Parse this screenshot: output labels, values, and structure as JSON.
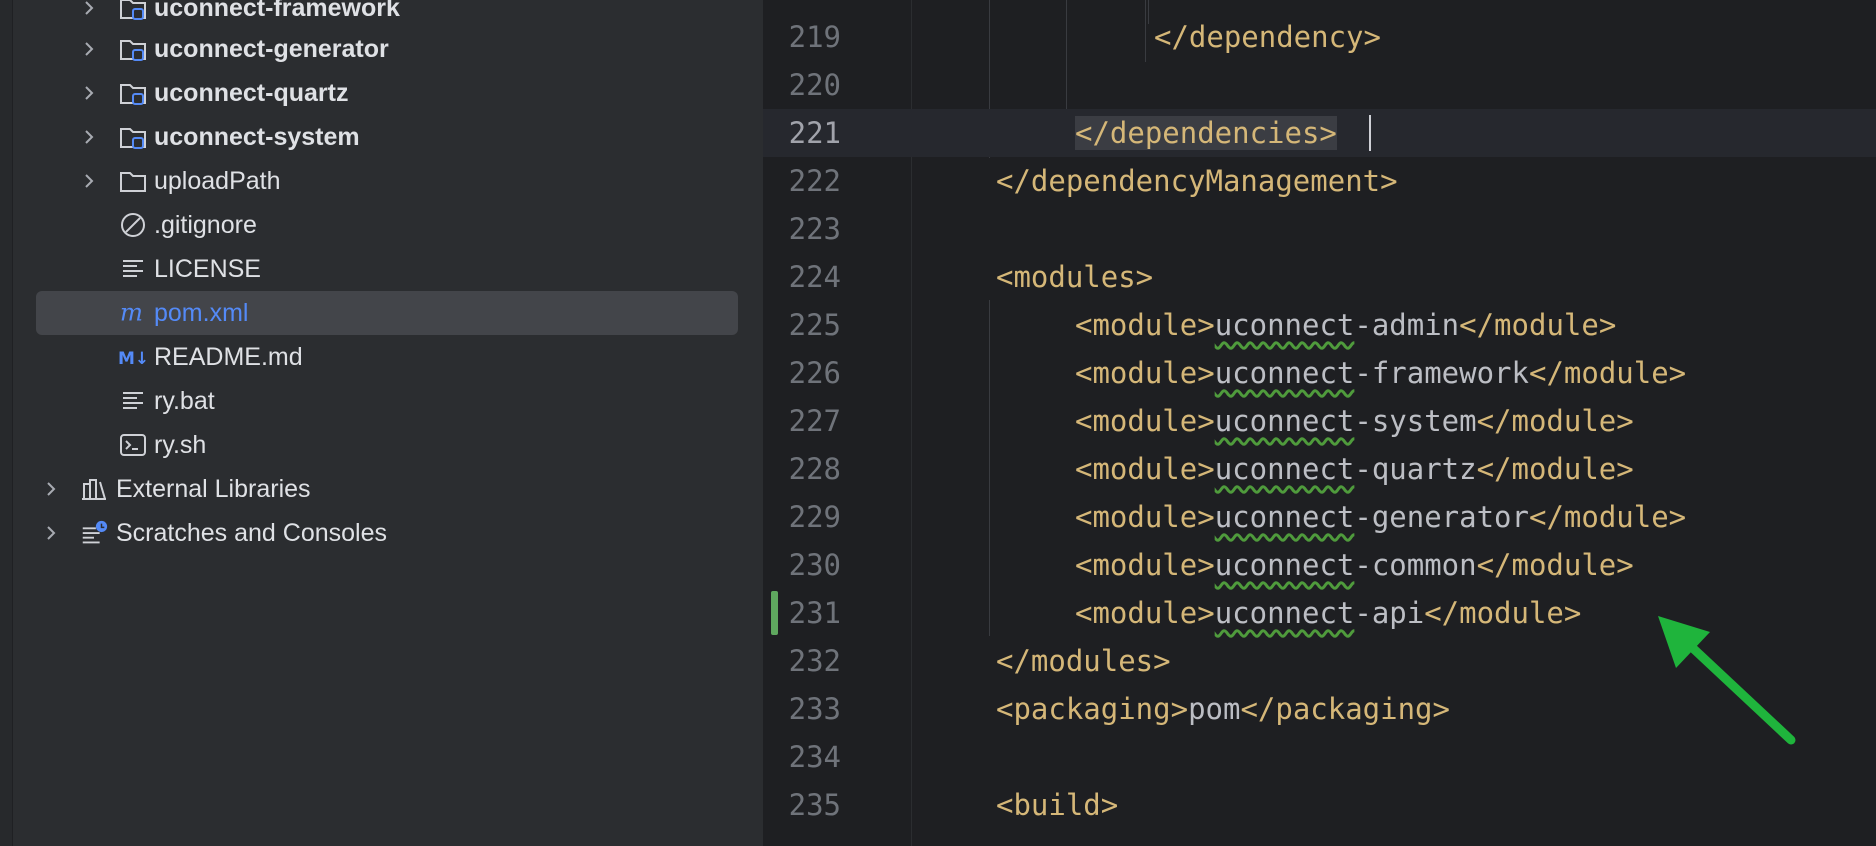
{
  "project_tree": {
    "items": [
      {
        "label": "uconnect-framework",
        "kind": "module-folder",
        "expandable": true
      },
      {
        "label": "uconnect-generator",
        "kind": "module-folder",
        "expandable": true
      },
      {
        "label": "uconnect-quartz",
        "kind": "module-folder",
        "expandable": true
      },
      {
        "label": "uconnect-system",
        "kind": "module-folder",
        "expandable": true
      },
      {
        "label": "uploadPath",
        "kind": "folder",
        "expandable": true
      },
      {
        "label": ".gitignore",
        "kind": "ignore-file"
      },
      {
        "label": "LICENSE",
        "kind": "text-file"
      },
      {
        "label": "pom.xml",
        "kind": "maven-file",
        "selected": true
      },
      {
        "label": "README.md",
        "kind": "markdown-file"
      },
      {
        "label": "ry.bat",
        "kind": "text-file"
      },
      {
        "label": "ry.sh",
        "kind": "shell-file"
      },
      {
        "label": "External Libraries",
        "kind": "libraries",
        "expandable": true
      },
      {
        "label": "Scratches and Consoles",
        "kind": "scratches",
        "expandable": true
      }
    ]
  },
  "editor": {
    "file": "pom.xml",
    "current_line": 221,
    "lines": [
      {
        "n": "219",
        "tokens": [
          {
            "t": "</dependency>",
            "c": "tag"
          }
        ]
      },
      {
        "n": "220",
        "tokens": []
      },
      {
        "n": "221",
        "tokens": [
          {
            "t": "</dependencies>",
            "c": "tag"
          }
        ]
      },
      {
        "n": "222",
        "tokens": [
          {
            "t": "</dependencyManagement>",
            "c": "tag"
          }
        ]
      },
      {
        "n": "223",
        "tokens": []
      },
      {
        "n": "224",
        "tokens": [
          {
            "t": "<modules>",
            "c": "tag"
          }
        ]
      },
      {
        "n": "225",
        "tokens": [
          {
            "t": "<module>",
            "c": "tag"
          },
          {
            "t": "uconnect",
            "c": "squig"
          },
          {
            "t": "-admin",
            "c": "txt"
          },
          {
            "t": "</module>",
            "c": "tag"
          }
        ]
      },
      {
        "n": "226",
        "tokens": [
          {
            "t": "<module>",
            "c": "tag"
          },
          {
            "t": "uconnect",
            "c": "squig"
          },
          {
            "t": "-framework",
            "c": "txt"
          },
          {
            "t": "</module>",
            "c": "tag"
          }
        ]
      },
      {
        "n": "227",
        "tokens": [
          {
            "t": "<module>",
            "c": "tag"
          },
          {
            "t": "uconnect",
            "c": "squig"
          },
          {
            "t": "-system",
            "c": "txt"
          },
          {
            "t": "</module>",
            "c": "tag"
          }
        ]
      },
      {
        "n": "228",
        "tokens": [
          {
            "t": "<module>",
            "c": "tag"
          },
          {
            "t": "uconnect",
            "c": "squig"
          },
          {
            "t": "-quartz",
            "c": "txt"
          },
          {
            "t": "</module>",
            "c": "tag"
          }
        ]
      },
      {
        "n": "229",
        "tokens": [
          {
            "t": "<module>",
            "c": "tag"
          },
          {
            "t": "uconnect",
            "c": "squig"
          },
          {
            "t": "-generator",
            "c": "txt"
          },
          {
            "t": "</module>",
            "c": "tag"
          }
        ]
      },
      {
        "n": "230",
        "tokens": [
          {
            "t": "<module>",
            "c": "tag"
          },
          {
            "t": "uconnect",
            "c": "squig"
          },
          {
            "t": "-common",
            "c": "txt"
          },
          {
            "t": "</module>",
            "c": "tag"
          }
        ]
      },
      {
        "n": "231",
        "tokens": [
          {
            "t": "<module>",
            "c": "tag"
          },
          {
            "t": "uconnect",
            "c": "squig"
          },
          {
            "t": "-api",
            "c": "txt"
          },
          {
            "t": "</module>",
            "c": "tag"
          }
        ],
        "changed": true
      },
      {
        "n": "232",
        "tokens": [
          {
            "t": "</modules>",
            "c": "tag"
          }
        ]
      },
      {
        "n": "233",
        "tokens": [
          {
            "t": "<packaging>",
            "c": "tag"
          },
          {
            "t": "pom",
            "c": "txt"
          },
          {
            "t": "</packaging>",
            "c": "tag"
          }
        ]
      },
      {
        "n": "234",
        "tokens": []
      },
      {
        "n": "235",
        "tokens": [
          {
            "t": "<build>",
            "c": "tag"
          }
        ]
      }
    ]
  },
  "colors": {
    "tag": "#d5b778",
    "text": "#bcbec4",
    "annotation_arrow": "#1fb43c",
    "change_marker": "#5fa85f",
    "link_blue": "#548af7"
  },
  "annotation": {
    "type": "arrow",
    "points_to_line": 231,
    "icon": "green-arrow-icon"
  }
}
